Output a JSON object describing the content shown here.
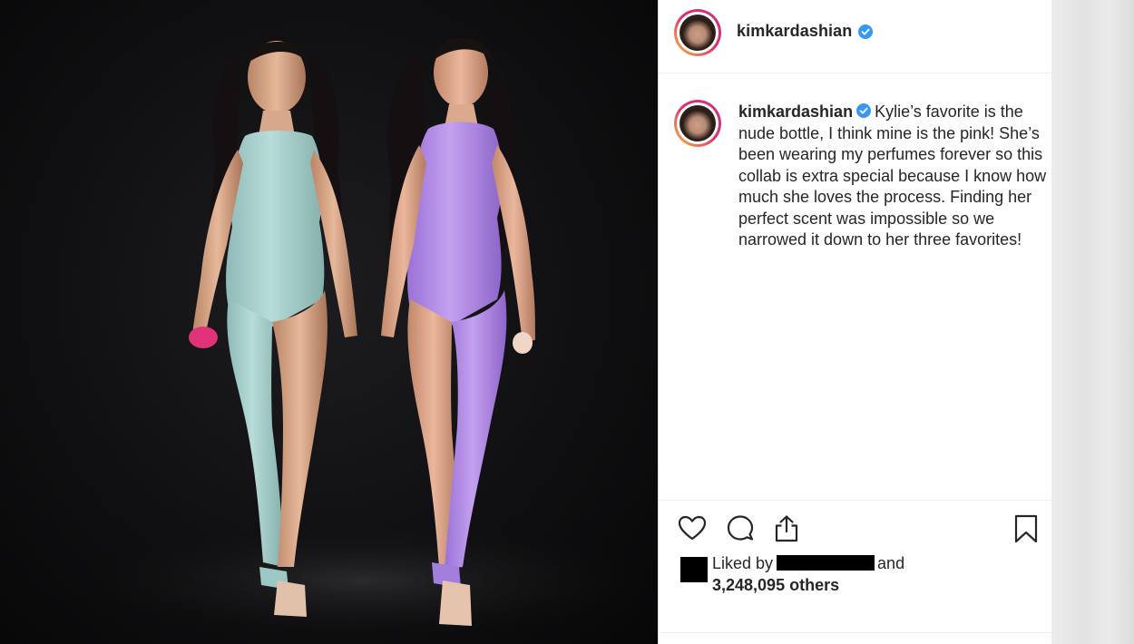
{
  "colors": {
    "verified": "#3897f0",
    "text": "#262626",
    "photo_bg": "#0f0f10",
    "left_bodysuit": "#a8d1cf",
    "right_bodysuit": "#b48ee6"
  },
  "post": {
    "username": "kimkardashian",
    "verified_icon": "verified-badge-icon",
    "caption": {
      "username": "kimkardashian",
      "text": "Kylie’s favorite is the nude bottle, I think mine is the pink! She’s been wearing my perfumes forever so this collab is extra special because I know how much she loves the process. Finding her perfect scent was impossible so we narrowed it down to her three favorites!"
    },
    "actions": {
      "like_icon": "heart-icon",
      "comment_icon": "comment-icon",
      "share_icon": "share-icon",
      "save_icon": "bookmark-icon"
    },
    "likes": {
      "prefix": "Liked by",
      "connector": "and",
      "count": "3,248,095 others"
    }
  }
}
